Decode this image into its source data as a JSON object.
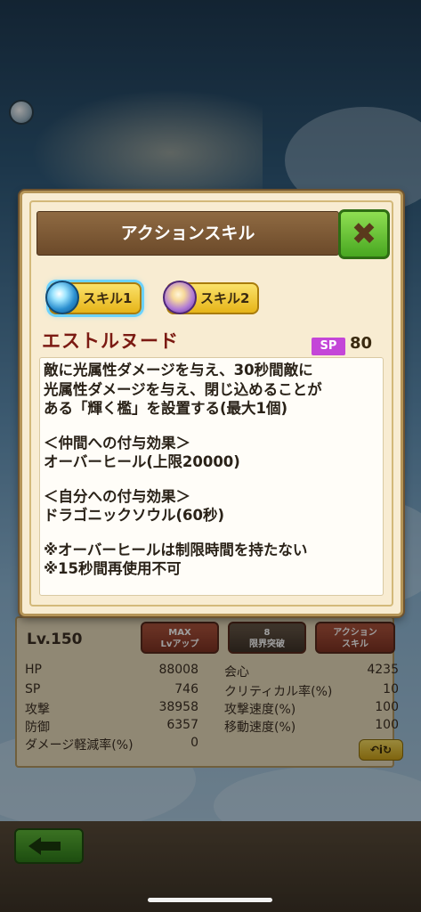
{
  "modal": {
    "title": "アクションスキル",
    "close_icon": "close-x-icon"
  },
  "tabs": [
    {
      "label": "スキル1",
      "icon": "water-orb-icon",
      "active": true
    },
    {
      "label": "スキル2",
      "icon": "light-orb-icon",
      "active": false
    }
  ],
  "skill": {
    "name": "エストルヌード",
    "sp_label": "SP",
    "sp_value": "80",
    "description": [
      "敵に光属性ダメージを与え、30秒間敵に",
      "光属性ダメージを与え、閉じ込めることが",
      "ある「輝く檻」を設置する(最大1個)",
      "",
      "＜仲間への付与効果＞",
      "オーバーヒール(上限20000)",
      "",
      "＜自分への付与効果＞",
      "ドラゴニックソウル(60秒)",
      "",
      "※オーバーヒールは制限時間を持たない",
      "※15秒間再使用不可"
    ]
  },
  "stats_panel": {
    "level": "Lv.150",
    "buttons": [
      {
        "line1": "MAX",
        "line2": "Lvアップ"
      },
      {
        "line1": "8",
        "line2": "限界突破"
      },
      {
        "line1": "アクション",
        "line2": "スキル"
      }
    ],
    "left": [
      {
        "label": "HP",
        "value": "88008"
      },
      {
        "label": "SP",
        "value": "746"
      },
      {
        "label": "攻撃",
        "value": "38958"
      },
      {
        "label": "防御",
        "value": "6357"
      },
      {
        "label": "ダメージ軽減率(%)",
        "value": "0"
      }
    ],
    "right": [
      {
        "label": "会心",
        "value": "4235"
      },
      {
        "label": "クリティカル率(%)",
        "value": "10"
      },
      {
        "label": "攻撃速度(%)",
        "value": "100"
      },
      {
        "label": "移動速度(%)",
        "value": "100"
      }
    ],
    "hint_label": "↶i↻"
  },
  "footer": {
    "back_icon": "back-arrow-icon"
  }
}
